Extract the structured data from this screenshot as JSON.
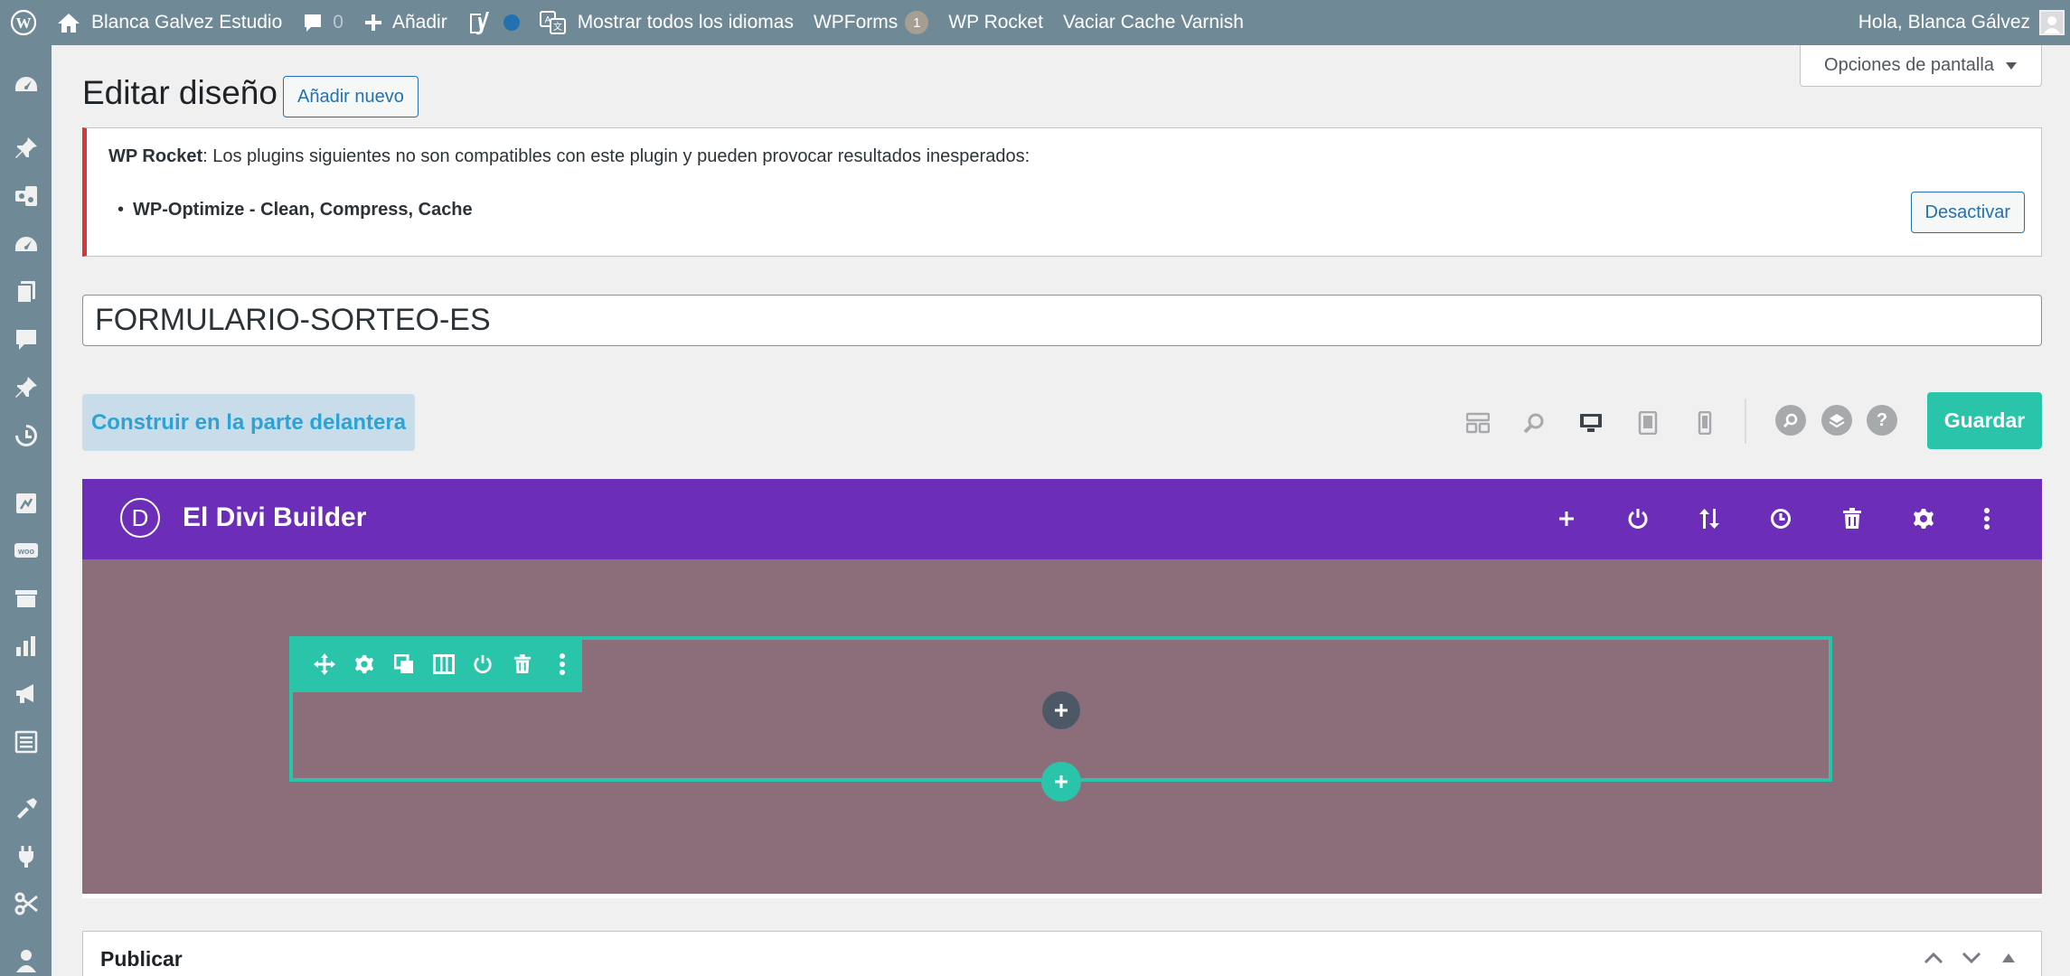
{
  "admin_bar": {
    "site_name": "Blanca Galvez Estudio",
    "comments_count": "0",
    "add_new": "Añadir",
    "languages": "Mostrar todos los idiomas",
    "wpforms": "WPForms",
    "wpforms_count": "1",
    "wp_rocket": "WP Rocket",
    "varnish": "Vaciar Cache Varnish",
    "greeting": "Hola, Blanca Gálvez"
  },
  "screen_options": "Opciones de pantalla",
  "page": {
    "title": "Editar diseño",
    "add_new": "Añadir nuevo"
  },
  "notice": {
    "plugin_name": "WP Rocket",
    "message": ": Los plugins siguientes no son compatibles con este plugin y pueden provocar resultados inesperados:",
    "incompatible_plugin": "WP-Optimize - Clean, Compress, Cache",
    "deactivate": "Desactivar"
  },
  "post_title": "FORMULARIO-SORTEO-ES",
  "toolbar": {
    "build_front": "Construir en la parte delantera",
    "save": "Guardar",
    "help": "?"
  },
  "divi": {
    "logo": "D",
    "title": "El Divi Builder"
  },
  "publish": {
    "title": "Publicar"
  },
  "colors": {
    "admin_bar": "#6f8a96",
    "divi_purple": "#6c2eb9",
    "divi_teal": "#29c4a9",
    "canvas": "#8c6e7b",
    "notice_error": "#d63638",
    "link_blue": "#2271b1"
  }
}
